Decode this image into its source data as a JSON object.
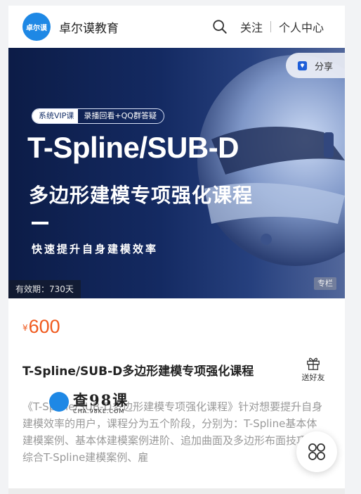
{
  "header": {
    "logo_text": "卓尔谟",
    "brand_name": "卓尔谟教育",
    "follow_label": "关注",
    "personal_center_label": "个人中心"
  },
  "banner": {
    "share_label": "分享",
    "tag_primary": "系统VIP课",
    "tag_secondary": "录播回看+QQ群答疑",
    "title_en": "T-Spline/SUB-D",
    "title_cn": "多边形建模专项强化课程",
    "subline": "快速提升自身建模效率",
    "validity": "有效期：730天",
    "type_badge": "专栏"
  },
  "course": {
    "currency_symbol": "¥",
    "price": "600",
    "title": "T-Spline/SUB-D多边形建模专项强化课程",
    "gift_label": "送好友",
    "description": "《T-Spline/SUB-D多边形建模专项强化课程》针对想要提升自身建模效率的用户，课程分为五个阶段，分别为：T-Spline基本体建模案例、基本体建模案例进阶、追加曲面及多边形布面技巧、综合T-Spline建模案例、雇"
  },
  "watermark": {
    "text": "查98课",
    "url": "CHA.98KE.COM"
  },
  "colors": {
    "price": "#f05a1e",
    "logo_bg": "#1e88e5",
    "banner_dark": "#0c1c47"
  },
  "icons": {
    "search": "search-icon",
    "share": "share-icon",
    "gift": "gift-icon",
    "menu": "grid-menu-icon"
  }
}
